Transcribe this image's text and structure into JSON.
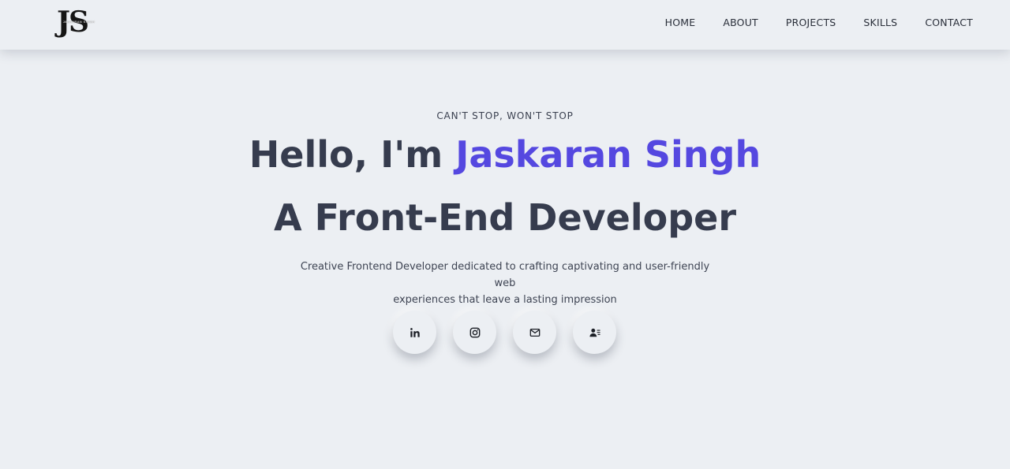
{
  "header": {
    "logo": {
      "letters": "JS",
      "subtitle": "JASKARAN SINGH"
    },
    "nav": [
      {
        "label": "HOME"
      },
      {
        "label": "ABOUT"
      },
      {
        "label": "PROJECTS"
      },
      {
        "label": "SKILLS"
      },
      {
        "label": "CONTACT"
      }
    ]
  },
  "hero": {
    "tagline": "CAN'T STOP, WON'T STOP",
    "greeting": "Hello, I'm ",
    "name": "Jaskaran Singh",
    "role": "A Front-End Developer",
    "description_line1": "Creative Frontend Developer dedicated to crafting captivating and user-friendly web",
    "description_line2": "experiences that leave a lasting impression"
  },
  "socials": [
    {
      "icon": "linkedin-icon"
    },
    {
      "icon": "instagram-icon"
    },
    {
      "icon": "mail-icon"
    },
    {
      "icon": "contact-card-icon"
    }
  ],
  "colors": {
    "background": "#eceff3",
    "accent": "#5548e0",
    "heading": "#363c4e"
  }
}
